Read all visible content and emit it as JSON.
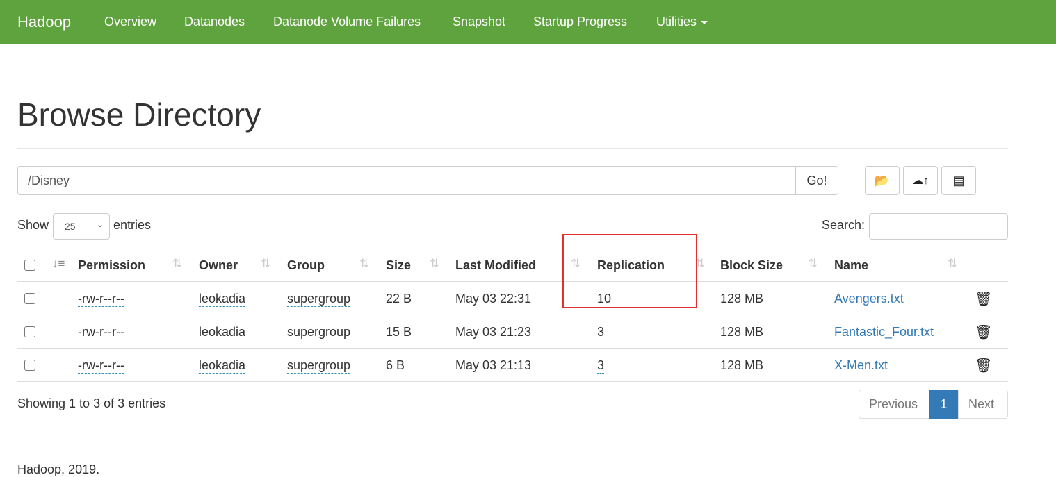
{
  "navbar": {
    "brand": "Hadoop",
    "items": [
      "Overview",
      "Datanodes",
      "Datanode Volume Failures",
      "Snapshot",
      "Startup Progress",
      "Utilities"
    ],
    "color": "#5fa33e"
  },
  "page": {
    "title": "Browse Directory"
  },
  "path_bar": {
    "value": "/Disney",
    "go_label": "Go!"
  },
  "toolbar": {
    "icons": [
      "folder-open-icon",
      "cloud-upload-icon",
      "list-icon"
    ]
  },
  "length": {
    "show_label": "Show",
    "selected": "25",
    "entries_label": "entries"
  },
  "search": {
    "label": "Search:",
    "value": ""
  },
  "table": {
    "columns": [
      "Permission",
      "Owner",
      "Group",
      "Size",
      "Last Modified",
      "Replication",
      "Block Size",
      "Name"
    ],
    "rows": [
      {
        "permission": "-rw-r--r--",
        "owner": "leokadia",
        "group": "supergroup",
        "size": "22 B",
        "modified": "May 03 22:31",
        "replication": "10",
        "block": "128 MB",
        "name": "Avengers.txt"
      },
      {
        "permission": "-rw-r--r--",
        "owner": "leokadia",
        "group": "supergroup",
        "size": "15 B",
        "modified": "May 03 21:23",
        "replication": "3",
        "block": "128 MB",
        "name": "Fantastic_Four.txt"
      },
      {
        "permission": "-rw-r--r--",
        "owner": "leokadia",
        "group": "supergroup",
        "size": "6 B",
        "modified": "May 03 21:13",
        "replication": "3",
        "block": "128 MB",
        "name": "X-Men.txt"
      }
    ]
  },
  "info": "Showing 1 to 3 of 3 entries",
  "pagination": {
    "previous": "Previous",
    "current": "1",
    "next": "Next"
  },
  "footer": "Hadoop, 2019.",
  "highlight_color": "#e0312f"
}
